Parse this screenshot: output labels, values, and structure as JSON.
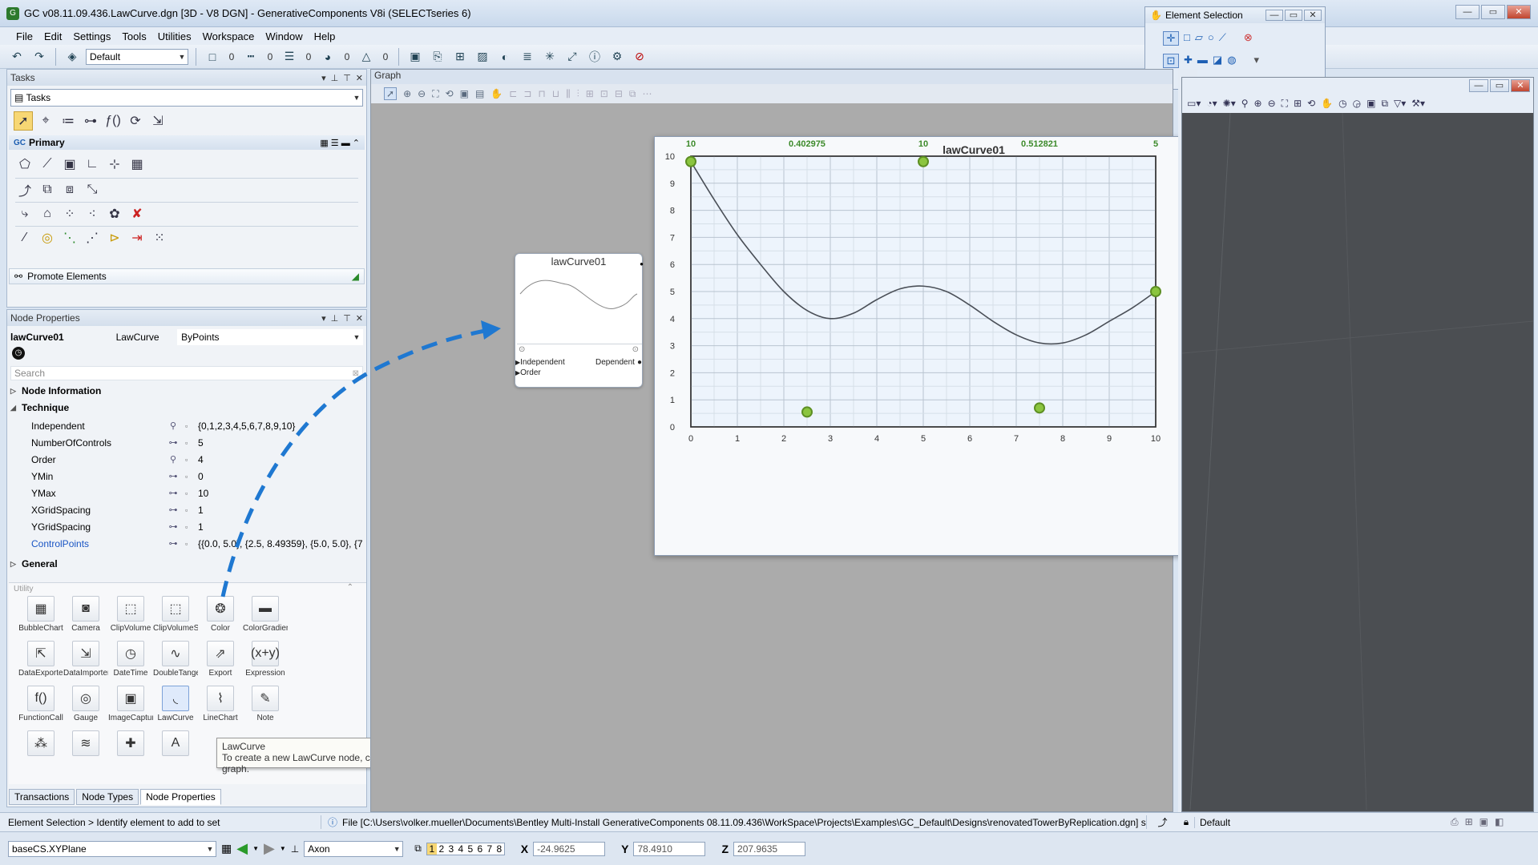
{
  "window": {
    "title": "GC v08.11.09.436.LawCurve.dgn [3D - V8 DGN] - GenerativeComponents V8i (SELECTseries 6)"
  },
  "menu": [
    "File",
    "Edit",
    "Settings",
    "Tools",
    "Utilities",
    "Workspace",
    "Window",
    "Help"
  ],
  "toolbar": {
    "level_combo": "Default",
    "color_num": "0",
    "style_num": "0",
    "weight_num": "0",
    "trans_num": "0",
    "prio_num": "0"
  },
  "element_selection": {
    "title": "Element Selection"
  },
  "tasks": {
    "title": "Tasks",
    "combo": "Tasks",
    "primary": "Primary",
    "promote": "Promote Elements"
  },
  "node_properties": {
    "title": "Node Properties",
    "node_name": "lawCurve01",
    "node_type": "LawCurve",
    "technique": "ByPoints",
    "search_placeholder": "Search",
    "sections": {
      "node_info": "Node Information",
      "technique": "Technique",
      "general": "General"
    },
    "rows": [
      {
        "name": "Independent",
        "value": "{0,1,2,3,4,5,6,7,8,9,10}",
        "link": false
      },
      {
        "name": "NumberOfControls",
        "value": "5",
        "link": false
      },
      {
        "name": "Order",
        "value": "4",
        "link": false
      },
      {
        "name": "YMin",
        "value": "0",
        "link": false
      },
      {
        "name": "YMax",
        "value": "10",
        "link": false
      },
      {
        "name": "XGridSpacing",
        "value": "1",
        "link": false
      },
      {
        "name": "YGridSpacing",
        "value": "1",
        "link": false
      },
      {
        "name": "ControlPoints",
        "value": "{{0.0, 5.0}, {2.5, 8.49359}, {5.0, 5.0}, {7",
        "link": true
      }
    ]
  },
  "library": {
    "section": "Utility",
    "items": [
      {
        "label": "BubbleChart",
        "icon": "▦"
      },
      {
        "label": "Camera",
        "icon": "◙"
      },
      {
        "label": "ClipVolume",
        "icon": "⬚"
      },
      {
        "label": "ClipVolumeStyle",
        "icon": "⬚"
      },
      {
        "label": "Color",
        "icon": "❂"
      },
      {
        "label": "ColorGradient",
        "icon": "▬"
      },
      {
        "label": "DataExporter",
        "icon": "⇱"
      },
      {
        "label": "DataImporter",
        "icon": "⇲"
      },
      {
        "label": "DateTime",
        "icon": "◷"
      },
      {
        "label": "DoubleTangen...",
        "icon": "∿"
      },
      {
        "label": "Export",
        "icon": "⇗"
      },
      {
        "label": "Expression",
        "icon": "(x+y)"
      },
      {
        "label": "FunctionCall",
        "icon": "f()"
      },
      {
        "label": "Gauge",
        "icon": "◎"
      },
      {
        "label": "ImageCapture",
        "icon": "▣"
      },
      {
        "label": "LawCurve",
        "icon": "◟"
      },
      {
        "label": "LineChart",
        "icon": "⌇"
      },
      {
        "label": "Note",
        "icon": "✎"
      },
      {
        "label": "",
        "icon": "⁂"
      },
      {
        "label": "",
        "icon": "≋"
      },
      {
        "label": "",
        "icon": "✚"
      },
      {
        "label": "",
        "icon": "A"
      }
    ],
    "tooltip_title": "LawCurve",
    "tooltip_text": "To create a new LawCurve node, click this icon or drag it onto the graph."
  },
  "panel_tabs": [
    "Transactions",
    "Node Types",
    "Node Properties"
  ],
  "graph": {
    "title": "Graph",
    "node": {
      "name": "lawCurve01",
      "input1": "Independent",
      "input2": "Order",
      "output": "Dependent"
    }
  },
  "chart_window": {
    "title": "lawCurve01",
    "close": "×"
  },
  "chart_data": {
    "type": "line",
    "title": "lawCurve01",
    "xlim": [
      0,
      10
    ],
    "ylim": [
      0,
      10
    ],
    "x_ticks": [
      "0",
      "1",
      "2",
      "3",
      "4",
      "5",
      "6",
      "7",
      "8",
      "9",
      "10"
    ],
    "y_ticks": [
      "0",
      "1",
      "2",
      "3",
      "4",
      "5",
      "6",
      "7",
      "8",
      "9",
      "10"
    ],
    "grid": true,
    "top_labels": [
      {
        "x": 0,
        "text": "10"
      },
      {
        "x": 2.5,
        "text": "0.402975"
      },
      {
        "x": 5,
        "text": "10"
      },
      {
        "x": 7.5,
        "text": "0.512821"
      },
      {
        "x": 10,
        "text": "5"
      }
    ],
    "control_points": [
      {
        "x": 0,
        "y": 9.8
      },
      {
        "x": 2.5,
        "y": 0.55
      },
      {
        "x": 5,
        "y": 9.8
      },
      {
        "x": 7.5,
        "y": 0.7
      },
      {
        "x": 10,
        "y": 5
      }
    ],
    "curve": {
      "x": [
        0,
        0.5,
        1,
        1.5,
        2,
        2.5,
        3,
        3.5,
        4,
        4.5,
        5,
        5.5,
        6,
        6.5,
        7,
        7.5,
        8,
        8.5,
        9,
        9.5,
        10
      ],
      "y": [
        9.8,
        8.4,
        7.1,
        6.0,
        5.0,
        4.3,
        4.0,
        4.2,
        4.7,
        5.1,
        5.2,
        5.0,
        4.5,
        3.9,
        3.4,
        3.1,
        3.1,
        3.4,
        3.9,
        4.4,
        5.0
      ]
    }
  },
  "status": {
    "left": "Element Selection > Identify element to add to set",
    "message": "File [C:\\Users\\volker.mueller\\Documents\\Bentley Multi-Install GenerativeComponents 08.11.09.436\\WorkSpace\\Projects\\Examples\\GC_Default\\Designs\\renovatedTowerByReplication.dgn] saved",
    "right": "Default"
  },
  "bottom": {
    "plane": "baseCS.XYPlane",
    "view_combo": "Axon",
    "views": [
      "1",
      "2",
      "3",
      "4",
      "5",
      "6",
      "7",
      "8"
    ],
    "x_label": "X",
    "x_value": "-24.9625",
    "y_label": "Y",
    "y_value": "78.4910",
    "z_label": "Z",
    "z_value": "207.9635"
  },
  "colors": {
    "accent_blue": "#1f78d1",
    "point_green": "#8bc53f",
    "label_green": "#3c8a2a",
    "view_bg": "#4a4d50"
  }
}
